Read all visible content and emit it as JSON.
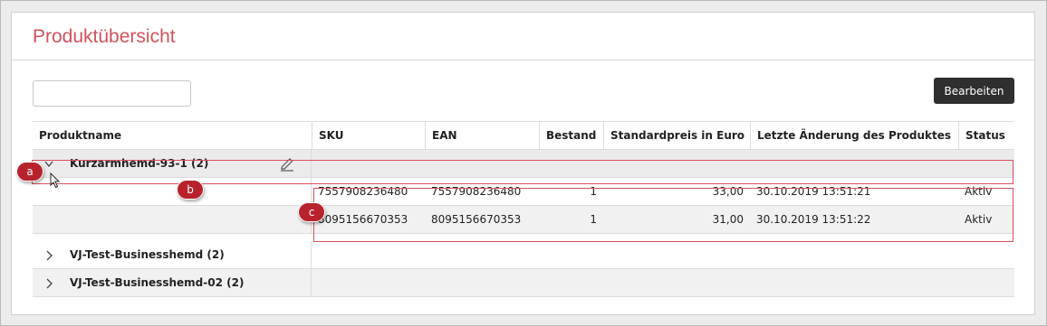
{
  "panel": {
    "title": "Produktübersicht"
  },
  "search": {
    "value": "",
    "placeholder": ""
  },
  "toolbar": {
    "edit_label": "Bearbeiten"
  },
  "table": {
    "headers": {
      "name": "Produktname",
      "sku": "SKU",
      "ean": "EAN",
      "stock": "Bestand",
      "price": "Standardpreis in Euro",
      "changed": "Letzte Änderung des Produktes",
      "status": "Status"
    },
    "groups": [
      {
        "label": "Kurzarmhemd-93-1 (2)",
        "expanded": true
      },
      {
        "label": "VJ-Test-Businesshemd (2)",
        "expanded": false
      },
      {
        "label": "VJ-Test-Businesshemd-02 (2)",
        "expanded": false
      }
    ],
    "rows": [
      {
        "sku": "7557908236480",
        "ean": "7557908236480",
        "stock": "1",
        "price": "33,00",
        "changed": "30.10.2019 13:51:21",
        "status": "Aktiv"
      },
      {
        "sku": "8095156670353",
        "ean": "8095156670353",
        "stock": "1",
        "price": "31,00",
        "changed": "30.10.2019 13:51:22",
        "status": "Aktiv"
      }
    ]
  },
  "annotations": {
    "a": "a",
    "b": "b",
    "c": "c"
  },
  "icons": {
    "chevron": "chevron-icon",
    "pencil": "pencil-icon",
    "cursor": "mouse-cursor-icon"
  },
  "colors": {
    "title": "#d4505c",
    "button_bg": "#2f2f2f",
    "annotation": "#b8222c",
    "highlight_border": "#d9505c"
  }
}
